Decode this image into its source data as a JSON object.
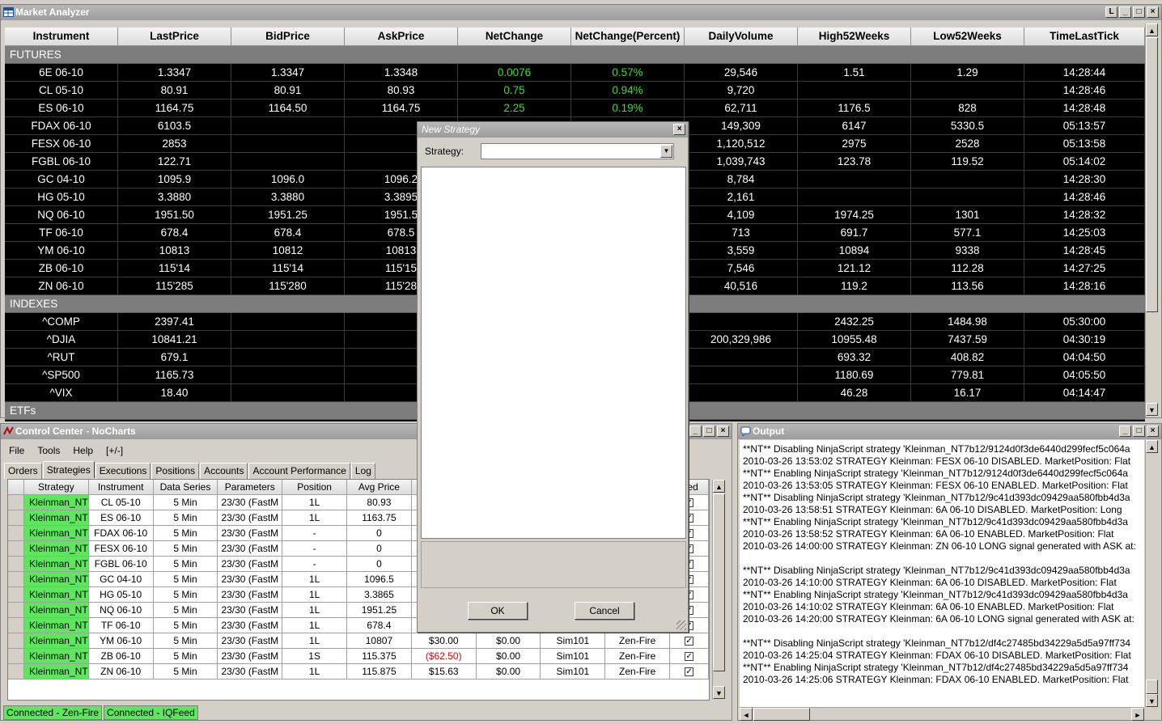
{
  "market_analyzer": {
    "title": "Market Analyzer",
    "columns": [
      "Instrument",
      "LastPrice",
      "BidPrice",
      "AskPrice",
      "NetChange",
      "NetChange(Percent)",
      "DailyVolume",
      "High52Weeks",
      "Low52Weeks",
      "TimeLastTick"
    ],
    "groups": [
      {
        "name": "FUTURES",
        "rows": [
          [
            "6E 06-10",
            "1.3347",
            "1.3347",
            "1.3348",
            "0.0076",
            "0.57%",
            "29,546",
            "1.51",
            "1.29",
            "14:28:44"
          ],
          [
            "CL 05-10",
            "80.91",
            "80.91",
            "80.93",
            "0.75",
            "0.94%",
            "9,720",
            "",
            "",
            "14:28:46"
          ],
          [
            "ES 06-10",
            "1164.75",
            "1164.50",
            "1164.75",
            "2.25",
            "0.19%",
            "62,711",
            "1176.5",
            "828",
            "14:28:48"
          ],
          [
            "FDAX 06-10",
            "6103.5",
            "",
            "",
            "",
            "",
            "149,309",
            "6147",
            "5330.5",
            "05:13:57"
          ],
          [
            "FESX 06-10",
            "2853",
            "",
            "",
            "",
            "",
            "1,120,512",
            "2975",
            "2528",
            "05:13:58"
          ],
          [
            "FGBL 06-10",
            "122.71",
            "",
            "",
            "",
            "",
            "1,039,743",
            "123.78",
            "119.52",
            "05:14:02"
          ],
          [
            "GC 04-10",
            "1095.9",
            "1096.0",
            "1096.2",
            "",
            "",
            "8,784",
            "",
            "",
            "14:28:30"
          ],
          [
            "HG 05-10",
            "3.3880",
            "3.3880",
            "3.3895",
            "",
            "",
            "2,161",
            "",
            "",
            "14:28:46"
          ],
          [
            "NQ 06-10",
            "1951.50",
            "1951.25",
            "1951.5",
            "",
            "",
            "4,109",
            "1974.25",
            "1301",
            "14:28:32"
          ],
          [
            "TF 06-10",
            "678.4",
            "678.4",
            "678.5",
            "",
            "",
            "713",
            "691.7",
            "577.1",
            "14:25:03"
          ],
          [
            "YM 06-10",
            "10813",
            "10812",
            "10813",
            "",
            "",
            "3,559",
            "10894",
            "9338",
            "14:28:45"
          ],
          [
            "ZB 06-10",
            "115'14",
            "115'14",
            "115'15",
            "",
            "",
            "7,546",
            "121.12",
            "112.28",
            "14:27:25"
          ],
          [
            "ZN 06-10",
            "115'285",
            "115'280",
            "115'28",
            "",
            "",
            "40,516",
            "119.2",
            "113.56",
            "14:28:16"
          ]
        ]
      },
      {
        "name": "INDEXES",
        "rows": [
          [
            "^COMP",
            "2397.41",
            "",
            "",
            "",
            "",
            "",
            "2432.25",
            "1484.98",
            "05:30:00"
          ],
          [
            "^DJIA",
            "10841.21",
            "",
            "",
            "",
            "",
            "200,329,986",
            "10955.48",
            "7437.59",
            "04:30:19"
          ],
          [
            "^RUT",
            "679.1",
            "",
            "",
            "",
            "",
            "",
            "693.32",
            "408.82",
            "04:04:50"
          ],
          [
            "^SP500",
            "1165.73",
            "",
            "",
            "",
            "",
            "",
            "1180.69",
            "779.81",
            "04:05:50"
          ],
          [
            "^VIX",
            "18.40",
            "",
            "",
            "",
            "",
            "",
            "46.28",
            "16.17",
            "04:14:47"
          ]
        ]
      },
      {
        "name": "ETFs",
        "rows": []
      }
    ],
    "positive_color": "#34e034"
  },
  "control_center": {
    "title": "Control Center - NoCharts",
    "menu": [
      "File",
      "Tools",
      "Help",
      "[+/-]"
    ],
    "tabs": [
      "Orders",
      "Strategies",
      "Executions",
      "Positions",
      "Accounts",
      "Account Performance",
      "Log"
    ],
    "active_tab": "Strategies",
    "columns": [
      "Strategy",
      "Instrument",
      "Data Series",
      "Parameters",
      "Position",
      "Avg Price",
      "",
      "",
      "",
      "",
      "bled"
    ],
    "rows": [
      [
        "Kleinman_NT",
        "CL 05-10",
        "5 Min",
        "23/30 (FastM",
        "1L",
        "80.93",
        "",
        "",
        "",
        "",
        ""
      ],
      [
        "Kleinman_NT",
        "ES 06-10",
        "5 Min",
        "23/30 (FastM",
        "1L",
        "1163.75",
        "",
        "",
        "",
        "",
        ""
      ],
      [
        "Kleinman_NT",
        "FDAX 06-10",
        "5 Min",
        "23/30 (FastM",
        "-",
        "0",
        "",
        "",
        "",
        "",
        ""
      ],
      [
        "Kleinman_NT",
        "FESX 06-10",
        "5 Min",
        "23/30 (FastM",
        "-",
        "0",
        "",
        "",
        "",
        "",
        ""
      ],
      [
        "Kleinman_NT",
        "FGBL 06-10",
        "5 Min",
        "23/30 (FastM",
        "-",
        "0",
        "",
        "",
        "",
        "",
        ""
      ],
      [
        "Kleinman_NT",
        "GC 04-10",
        "5 Min",
        "23/30 (FastM",
        "1L",
        "1096.5",
        "",
        "",
        "",
        "",
        ""
      ],
      [
        "Kleinman_NT",
        "HG 05-10",
        "5 Min",
        "23/30 (FastM",
        "1L",
        "3.3865",
        "",
        "",
        "",
        "",
        ""
      ],
      [
        "Kleinman_NT",
        "NQ 06-10",
        "5 Min",
        "23/30 (FastM",
        "1L",
        "1951.25",
        "",
        "",
        "",
        "",
        ""
      ],
      [
        "Kleinman_NT",
        "TF 06-10",
        "5 Min",
        "23/30 (FastM",
        "1L",
        "678.4",
        "",
        "",
        "",
        "",
        ""
      ],
      [
        "Kleinman_NT",
        "YM 06-10",
        "5 Min",
        "23/30 (FastM",
        "1L",
        "10807",
        "$30.00",
        "$0.00",
        "Sim101",
        "Zen-Fire",
        ""
      ],
      [
        "Kleinman_NT",
        "ZB 06-10",
        "5 Min",
        "23/30 (FastM",
        "1S",
        "115.375",
        "($62.50)",
        "$0.00",
        "Sim101",
        "Zen-Fire",
        ""
      ],
      [
        "Kleinman_NT",
        "ZN 06-10",
        "5 Min",
        "23/30 (FastM",
        "1L",
        "115.875",
        "$15.63",
        "$0.00",
        "Sim101",
        "Zen-Fire",
        ""
      ]
    ],
    "status": [
      "Connected - Zen-Fire",
      "Connected - IQFeed"
    ],
    "strategy_color": "#5ee65e",
    "negative_color": "#e00000"
  },
  "output": {
    "title": "Output",
    "lines": [
      "**NT** Disabling NinjaScript strategy 'Kleinman_NT7b12/9124d0f3de6440d299fecf5c064a",
      "2010-03-26 13:53:02 STRATEGY Kleinman: FESX 06-10 DISABLED. MarketPosition: Flat",
      "**NT** Enabling NinjaScript strategy 'Kleinman_NT7b12/9124d0f3de6440d299fecf5c064a",
      "2010-03-26 13:53:05 STRATEGY Kleinman: FESX 06-10 ENABLED. MarketPosition: Flat",
      "**NT** Disabling NinjaScript strategy 'Kleinman_NT7b12/9c41d393dc09429aa580fbb4d3a",
      "2010-03-26 13:58:51 STRATEGY Kleinman: 6A 06-10 DISABLED. MarketPosition: Long",
      "**NT** Enabling NinjaScript strategy 'Kleinman_NT7b12/9c41d393dc09429aa580fbb4d3a",
      "2010-03-26 13:58:52 STRATEGY Kleinman: 6A 06-10 ENABLED. MarketPosition: Flat",
      "2010-03-26 14:00:00 STRATEGY Kleinman: ZN 06-10 LONG signal generated with ASK at:",
      "",
      "**NT** Disabling NinjaScript strategy 'Kleinman_NT7b12/9c41d393dc09429aa580fbb4d3a",
      "2010-03-26 14:10:00 STRATEGY Kleinman: 6A 06-10 DISABLED. MarketPosition: Flat",
      "**NT** Enabling NinjaScript strategy 'Kleinman_NT7b12/9c41d393dc09429aa580fbb4d3a",
      "2010-03-26 14:10:02 STRATEGY Kleinman: 6A 06-10 ENABLED. MarketPosition: Flat",
      "2010-03-26 14:20:00 STRATEGY Kleinman: 6A 06-10 LONG signal generated with ASK at:",
      "",
      "**NT** Disabling NinjaScript strategy 'Kleinman_NT7b12/df4c27485bd34229a5d5a97ff734",
      "2010-03-26 14:25:04 STRATEGY Kleinman: FDAX 06-10 DISABLED. MarketPosition: Flat",
      "**NT** Enabling NinjaScript strategy 'Kleinman_NT7b12/df4c27485bd34229a5d5a97ff734",
      "2010-03-26 14:25:06 STRATEGY Kleinman: FDAX 06-10 ENABLED. MarketPosition: Flat"
    ]
  },
  "dialog": {
    "title": "New Strategy",
    "strategy_label": "Strategy:",
    "strategy_value": "",
    "ok_label": "OK",
    "cancel_label": "Cancel"
  }
}
